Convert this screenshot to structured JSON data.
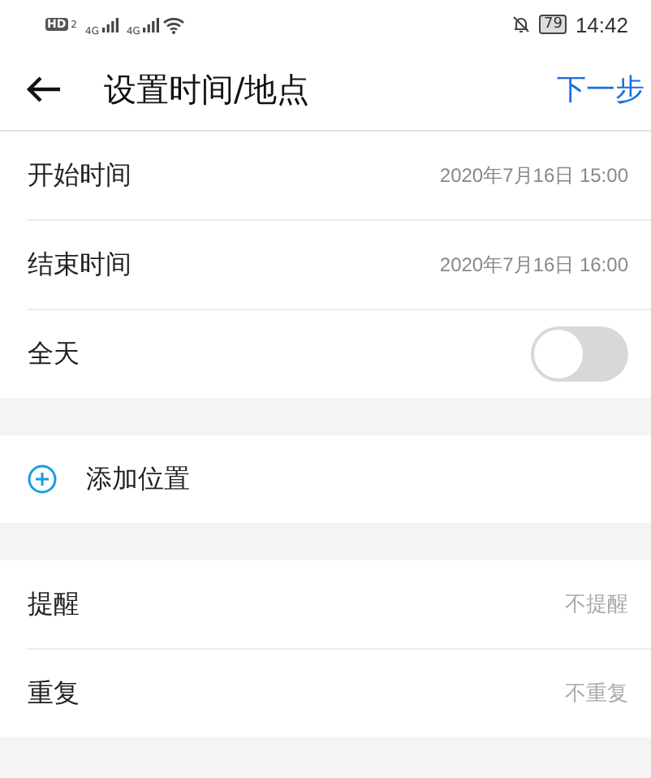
{
  "status_bar": {
    "hd": "HD",
    "sim": "2",
    "network_1": "4G",
    "network_2": "4G",
    "battery": "79",
    "time": "14:42"
  },
  "header": {
    "title": "设置时间/地点",
    "action": "下一步"
  },
  "sections": [
    {
      "rows": [
        {
          "kind": "value",
          "label": "开始时间",
          "value": "2020年7月16日 15:00"
        },
        {
          "kind": "value",
          "label": "结束时间",
          "value": "2020年7月16日 16:00"
        },
        {
          "kind": "toggle",
          "label": "全天",
          "on": false
        }
      ]
    },
    {
      "rows": [
        {
          "kind": "action",
          "label": "添加位置"
        }
      ]
    },
    {
      "rows": [
        {
          "kind": "hint",
          "label": "提醒",
          "value": "不提醒"
        },
        {
          "kind": "hint",
          "label": "重复",
          "value": "不重复"
        }
      ]
    }
  ]
}
